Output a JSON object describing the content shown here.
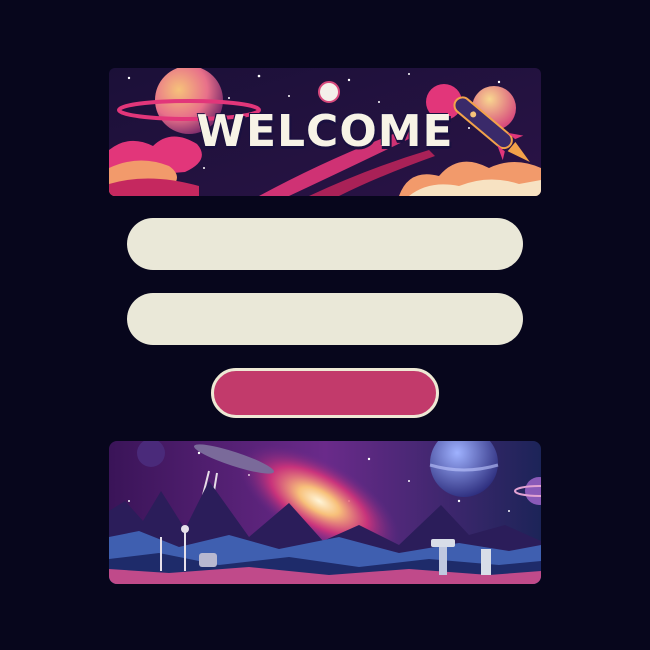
{
  "banner": {
    "title": "WELCOME",
    "icon": "rocket-icon"
  },
  "form": {
    "username_value": "",
    "username_placeholder": "",
    "password_value": "",
    "password_placeholder": "",
    "submit_label": ""
  },
  "scene": {
    "description_icon": "space-landscape-image"
  },
  "colors": {
    "background": "#07061c",
    "field_fill": "#eae8d8",
    "button_fill": "#c23a6b",
    "button_border": "#eee9d5",
    "accent_pink": "#e2367a",
    "accent_orange": "#f2a24a"
  }
}
